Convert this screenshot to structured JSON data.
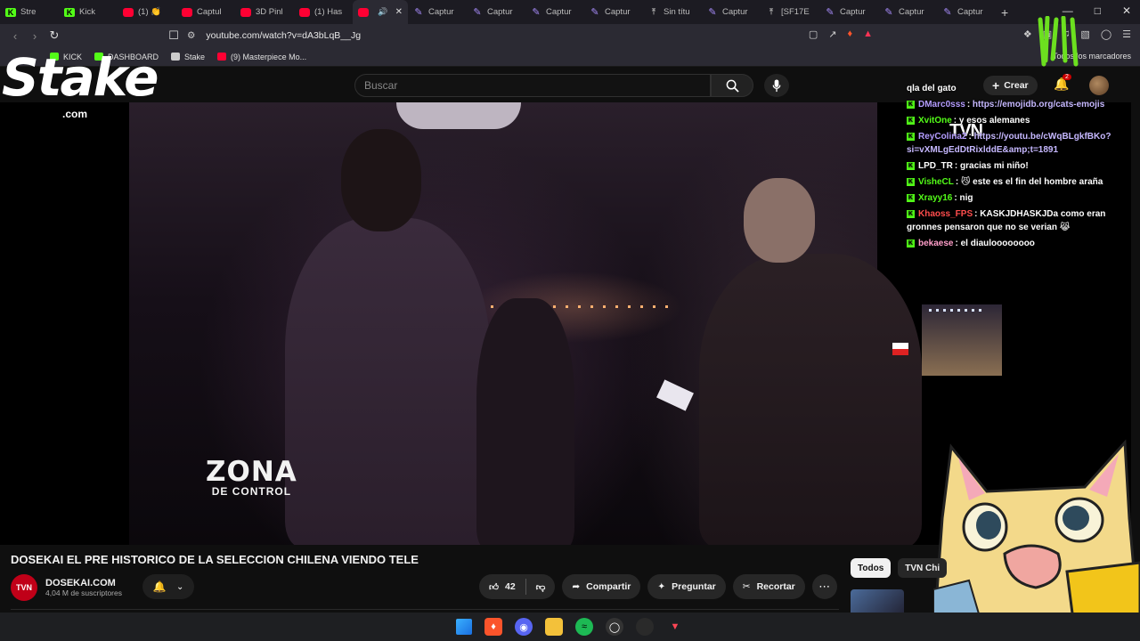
{
  "browser": {
    "tabs": [
      {
        "label": "Stre",
        "icon": "kick-icon"
      },
      {
        "label": "Kick",
        "icon": "kick-icon"
      },
      {
        "label": "(1) 👏",
        "icon": "youtube-icon"
      },
      {
        "label": "Captul",
        "icon": "youtube-icon"
      },
      {
        "label": "3D Pinl",
        "icon": "youtube-icon"
      },
      {
        "label": "(1) Has",
        "icon": "youtube-icon"
      },
      {
        "label": "",
        "icon": "youtube-icon",
        "active": true
      },
      {
        "label": "Captur",
        "icon": "pen-icon"
      },
      {
        "label": "Captur",
        "icon": "pen-icon"
      },
      {
        "label": "Captur",
        "icon": "pen-icon"
      },
      {
        "label": "Captur",
        "icon": "pen-icon"
      },
      {
        "label": "Sin títu",
        "icon": "upload-icon"
      },
      {
        "label": "Captur",
        "icon": "pen-icon"
      },
      {
        "label": "[SF17E",
        "icon": "upload-icon"
      },
      {
        "label": "Captur",
        "icon": "pen-icon"
      },
      {
        "label": "Captur",
        "icon": "pen-icon"
      },
      {
        "label": "Captur",
        "icon": "pen-icon"
      }
    ],
    "url": "youtube.com/watch?v=dA3bLqB__Jg",
    "bookmarks": [
      {
        "label": "KICK",
        "icon": "kick-icon",
        "color": "#53fc18"
      },
      {
        "label": "DASHBOARD",
        "icon": "kick-icon",
        "color": "#53fc18"
      },
      {
        "label": "Stake",
        "icon": "stake-icon",
        "color": "#cccccc"
      },
      {
        "label": "(9) Masterpiece Mo...",
        "icon": "youtube-icon",
        "color": "#ff0033"
      }
    ],
    "all_bookmarks": "Todos los marcadores"
  },
  "youtube": {
    "search_placeholder": "Buscar",
    "create_label": "Crear",
    "notification_count": "2",
    "video_title": "DOSEKAI EL PRE HISTORICO DE LA SELECCION CHILENA VIENDO TELE",
    "channel_name": "DOSEKAI.COM",
    "channel_logo_text": "TVN",
    "subscribers": "4,04 M de suscriptores",
    "likes": "42",
    "share_label": "Compartir",
    "ask_label": "Preguntar",
    "clip_label": "Recortar",
    "chips": [
      "Todos",
      "TVN Chi"
    ]
  },
  "overlay": {
    "zona_line1": "ZONA",
    "zona_line2": "DE CONTROL",
    "stake_text": "Stake",
    "stake_domain": ".com",
    "tvn_text": "TVN",
    "chat": [
      {
        "user": "",
        "text": "qla del gato",
        "user_color": "#ffffff"
      },
      {
        "user": "DMarc0sss",
        "text": "https://emojidb.org/cats-emojis",
        "user_color": "#b49cff",
        "link": true
      },
      {
        "user": "XvitOne",
        "text": "y esos alemanes",
        "user_color": "#53fc18"
      },
      {
        "user": "ReyColina2",
        "text": "https://youtu.be/cWqBLgkfBKo?si=vXMLgEdDtRixlddE&amp;t=1891",
        "user_color": "#b49cff",
        "link": true
      },
      {
        "user": "LPD_TR",
        "text": "gracias mi niño!",
        "user_color": "#ffffff"
      },
      {
        "user": "VisheCL",
        "text": "😼 este es el fin del hombre araña",
        "user_color": "#53fc18"
      },
      {
        "user": "Xrayy16",
        "text": "nig",
        "user_color": "#53fc18"
      },
      {
        "user": "Khaoss_FPS",
        "text": "KASKJDHASKJDa como eran gronnes pensaron que no se verian 😹",
        "user_color": "#ff4d4d"
      },
      {
        "user": "bekaese",
        "text": "el diauloooooooo",
        "user_color": "#ff9ec9"
      }
    ]
  }
}
